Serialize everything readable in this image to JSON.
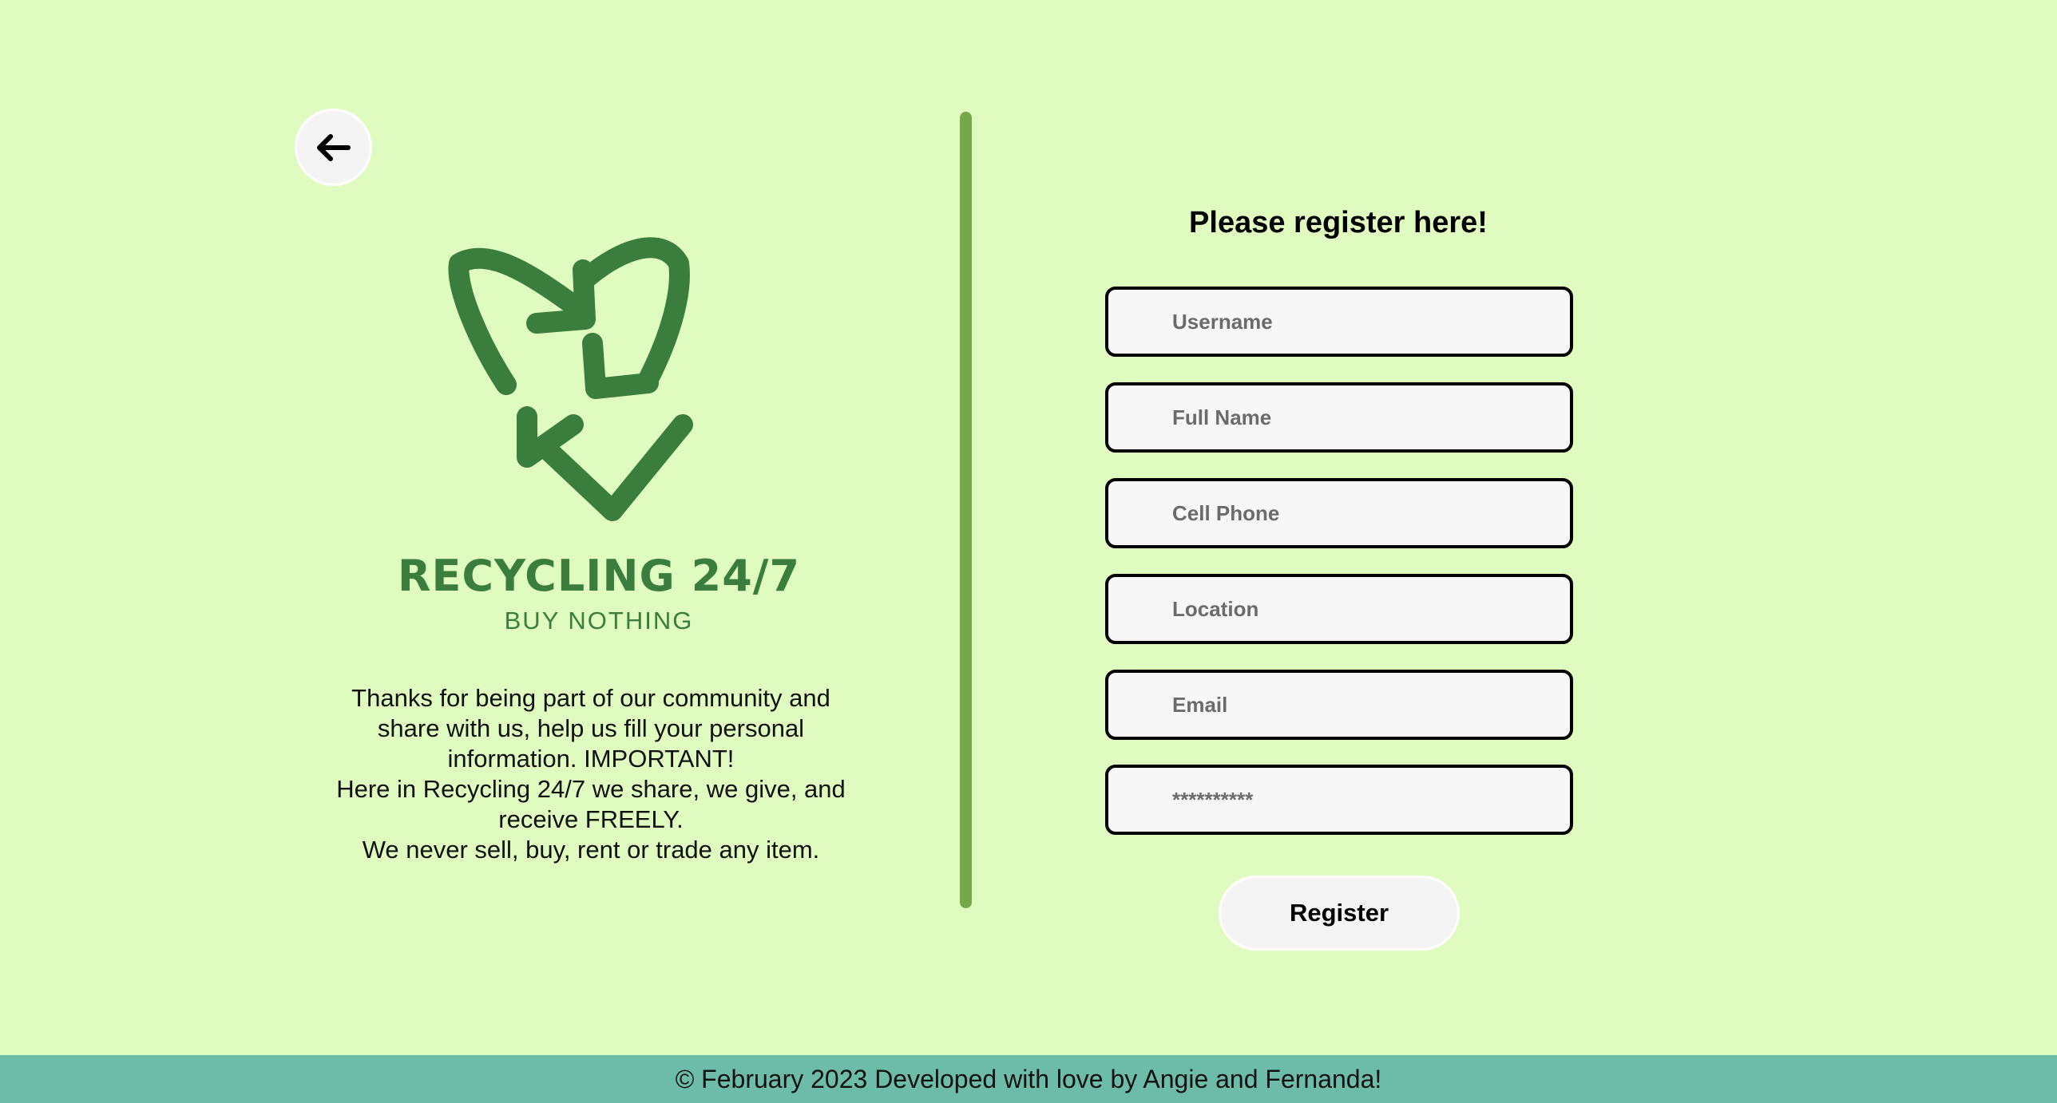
{
  "colors": {
    "background": "#e0fbbf",
    "brand_green": "#3a7d3c",
    "divider_green": "#76a84a",
    "footer_teal": "#6dbcaa"
  },
  "back_button": {
    "icon": "arrow-left-icon"
  },
  "logo": {
    "icon": "recycle-icon"
  },
  "brand": {
    "title": "RECYCLING 24/7",
    "subtitle": "BUY NOTHING"
  },
  "intro": {
    "lines": [
      "Thanks for being part of our community and",
      "share with us, help us fill your personal",
      "information. IMPORTANT!",
      "Here in Recycling 24/7 we share, we give, and",
      "receive FREELY.",
      "We never sell, buy, rent or trade any item."
    ]
  },
  "form": {
    "title": "Please register here!",
    "fields": {
      "username": {
        "placeholder": "Username",
        "value": ""
      },
      "full_name": {
        "placeholder": "Full Name",
        "value": ""
      },
      "cell_phone": {
        "placeholder": "Cell Phone",
        "value": ""
      },
      "location": {
        "placeholder": "Location",
        "value": ""
      },
      "email": {
        "placeholder": "Email",
        "value": ""
      },
      "password": {
        "placeholder": "**********",
        "value": ""
      }
    },
    "submit_label": "Register"
  },
  "footer": {
    "text": "© February 2023 Developed with love by Angie and Fernanda!"
  }
}
